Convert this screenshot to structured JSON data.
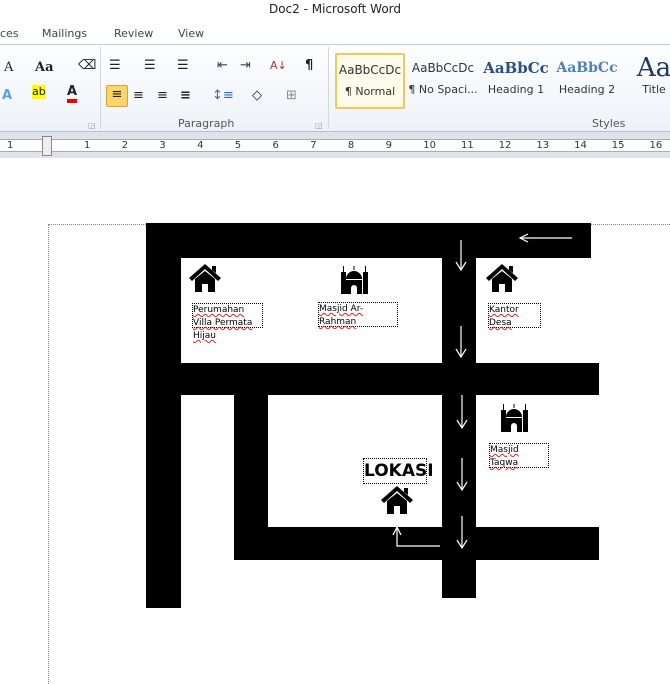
{
  "window": {
    "title": "Doc2 - Microsoft Word"
  },
  "tabs": [
    "ces",
    "Mailings",
    "Review",
    "View"
  ],
  "ribbon": {
    "groups": {
      "paragraph": "Paragraph",
      "styles": "Styles"
    },
    "styles": [
      {
        "preview": "AaBbCcDc",
        "name": "¶ Normal",
        "selected": true
      },
      {
        "preview": "AaBbCcDc",
        "name": "¶ No Spaci..."
      },
      {
        "preview": "AaBbCc",
        "name": "Heading 1"
      },
      {
        "preview": "AaBbCc",
        "name": "Heading 2"
      },
      {
        "preview": "Aa",
        "name": "Title"
      }
    ],
    "icons": {
      "font_grow": "A",
      "change_case": "Aa",
      "pilcrow": "¶"
    }
  },
  "ruler": {
    "ticks": [
      "1",
      "1",
      "2",
      "3",
      "4",
      "5",
      "6",
      "7",
      "8",
      "9",
      "10",
      "11",
      "12",
      "13",
      "14",
      "15",
      "16"
    ]
  },
  "map": {
    "labels": {
      "perumahan": "Perumahan Villa Permata Hijau",
      "masjid1": "Masjid Ar-Rahman",
      "kantor": "Kantor Desa",
      "masjid2": "Masjid Taqwa",
      "lokasi": "LOKASI"
    }
  }
}
